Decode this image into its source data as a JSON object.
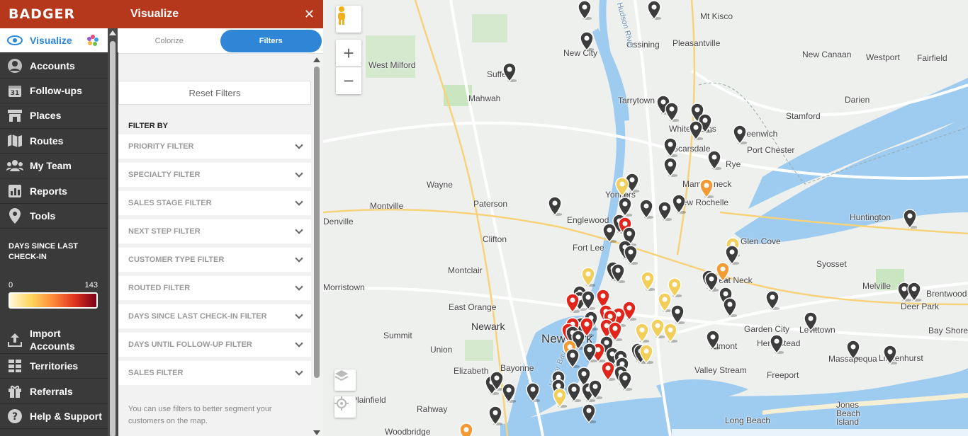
{
  "brand": "BADGER",
  "nav": [
    {
      "label": "Visualize",
      "icon": "eye-icon",
      "active": true
    },
    {
      "label": "Accounts",
      "icon": "person-icon"
    },
    {
      "label": "Follow-ups",
      "icon": "calendar-icon"
    },
    {
      "label": "Places",
      "icon": "storefront-icon"
    },
    {
      "label": "Routes",
      "icon": "map-icon"
    },
    {
      "label": "My Team",
      "icon": "team-icon"
    },
    {
      "label": "Reports",
      "icon": "chart-icon"
    },
    {
      "label": "Tools",
      "icon": "pin-icon"
    }
  ],
  "nav_bottom": [
    {
      "label": "Import Accounts",
      "icon": "upload-icon"
    },
    {
      "label": "Territories",
      "icon": "grid-icon"
    },
    {
      "label": "Referrals",
      "icon": "gift-icon"
    },
    {
      "label": "Help & Support",
      "icon": "help-icon"
    }
  ],
  "legend": {
    "title": "DAYS SINCE LAST CHECK-IN",
    "min": "0",
    "max": "143"
  },
  "panel": {
    "title": "Visualize",
    "close": "✕",
    "tabs": [
      {
        "label": "Colorize",
        "active": false
      },
      {
        "label": "Filters",
        "active": true
      }
    ],
    "reset": "Reset Filters",
    "filter_by": "FILTER BY",
    "filters": [
      "PRIORITY FILTER",
      "SPECIALTY FILTER",
      "SALES STAGE FILTER",
      "NEXT STEP FILTER",
      "CUSTOMER TYPE FILTER",
      "ROUTED FILTER",
      "DAYS SINCE LAST CHECK-IN FILTER",
      "DAYS UNTIL FOLLOW-UP FILTER",
      "SALES FILTER"
    ],
    "help": "You can use filters to better segment your customers on the map."
  },
  "map": {
    "zoom_in": "+",
    "zoom_out": "−",
    "places": [
      {
        "name": "Mt Kisco",
        "cls": ""
      },
      {
        "name": "New City",
        "cls": ""
      },
      {
        "name": "Ossining",
        "cls": ""
      },
      {
        "name": "Pleasantville",
        "cls": ""
      },
      {
        "name": "New Canaan",
        "cls": ""
      },
      {
        "name": "Westport",
        "cls": ""
      },
      {
        "name": "Fairfield",
        "cls": ""
      },
      {
        "name": "West Milford",
        "cls": ""
      },
      {
        "name": "Suffern",
        "cls": ""
      },
      {
        "name": "Mahwah",
        "cls": ""
      },
      {
        "name": "Tarrytown",
        "cls": ""
      },
      {
        "name": "Stamford",
        "cls": ""
      },
      {
        "name": "Darien",
        "cls": ""
      },
      {
        "name": "White Plains",
        "cls": ""
      },
      {
        "name": "Greenwich",
        "cls": ""
      },
      {
        "name": "Port Chester",
        "cls": ""
      },
      {
        "name": "Rye",
        "cls": ""
      },
      {
        "name": "Scarsdale",
        "cls": ""
      },
      {
        "name": "Wayne",
        "cls": ""
      },
      {
        "name": "Yonkers",
        "cls": ""
      },
      {
        "name": "Mamaroneck",
        "cls": ""
      },
      {
        "name": "Montville",
        "cls": ""
      },
      {
        "name": "Paterson",
        "cls": ""
      },
      {
        "name": "New Rochelle",
        "cls": ""
      },
      {
        "name": "Denville",
        "cls": ""
      },
      {
        "name": "Englewood",
        "cls": ""
      },
      {
        "name": "Huntington",
        "cls": ""
      },
      {
        "name": "Clifton",
        "cls": ""
      },
      {
        "name": "Fort Lee",
        "cls": ""
      },
      {
        "name": "Glen Cove",
        "cls": ""
      },
      {
        "name": "Montclair",
        "cls": ""
      },
      {
        "name": "Syosset",
        "cls": ""
      },
      {
        "name": "Morristown",
        "cls": ""
      },
      {
        "name": "Great Neck",
        "cls": ""
      },
      {
        "name": "Melville",
        "cls": ""
      },
      {
        "name": "Brentwood",
        "cls": ""
      },
      {
        "name": "East Orange",
        "cls": ""
      },
      {
        "name": "Deer Park",
        "cls": ""
      },
      {
        "name": "Newark",
        "cls": ""
      },
      {
        "name": "New York",
        "cls": "big"
      },
      {
        "name": "Garden City",
        "cls": ""
      },
      {
        "name": "Levittown",
        "cls": ""
      },
      {
        "name": "Bay Shore",
        "cls": ""
      },
      {
        "name": "Summit",
        "cls": ""
      },
      {
        "name": "Union",
        "cls": ""
      },
      {
        "name": "Elmont",
        "cls": ""
      },
      {
        "name": "Hempstead",
        "cls": ""
      },
      {
        "name": "Massapequa",
        "cls": ""
      },
      {
        "name": "Lindenhurst",
        "cls": ""
      },
      {
        "name": "Bayonne",
        "cls": ""
      },
      {
        "name": "Elizabeth",
        "cls": ""
      },
      {
        "name": "Valley Stream",
        "cls": ""
      },
      {
        "name": "Freeport",
        "cls": ""
      },
      {
        "name": "Plainfield",
        "cls": ""
      },
      {
        "name": "Rahway",
        "cls": ""
      },
      {
        "name": "Jones Beach Island",
        "cls": ""
      },
      {
        "name": "Long Beach",
        "cls": ""
      },
      {
        "name": "Woodbridge",
        "cls": ""
      },
      {
        "name": "Hudson River",
        "cls": "water"
      },
      {
        "name": "Upper Bay",
        "cls": "water"
      }
    ],
    "pin_colors": {
      "gray": "#3c3c3c",
      "yellow": "#f2cf5b",
      "orange": "#f29a34",
      "red": "#e1251b"
    }
  }
}
